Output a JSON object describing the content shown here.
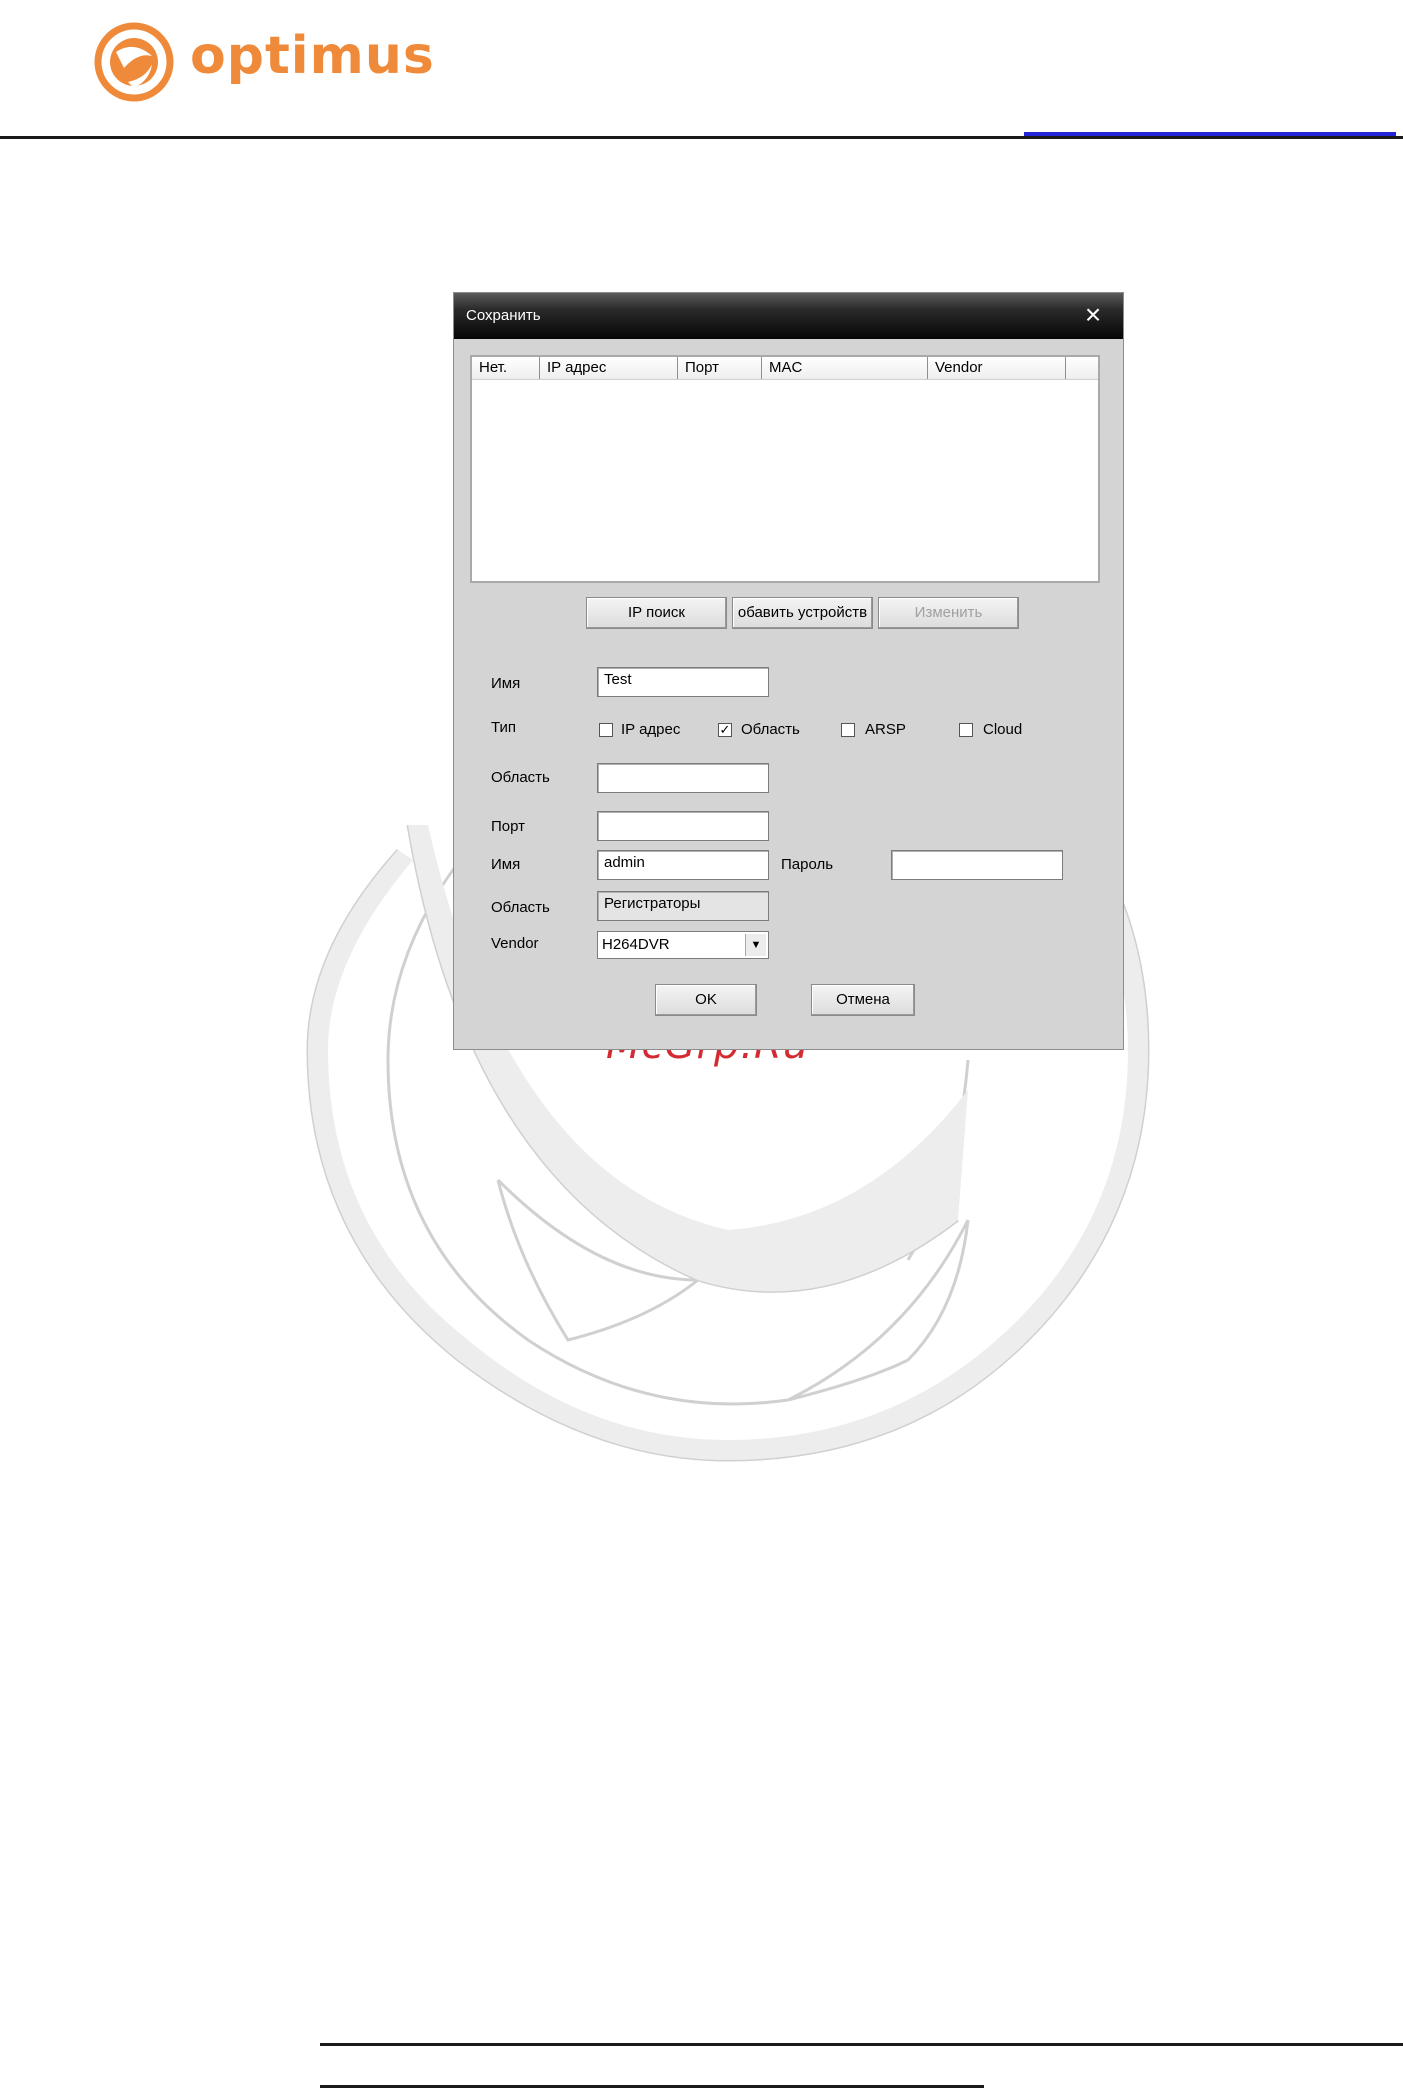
{
  "header": {
    "brand": "optimus",
    "brand_color": "#ef8a3a"
  },
  "watermark_text": "McGrp.Ru",
  "dialog": {
    "title": "Сохранить",
    "close_icon": "close-icon",
    "list": {
      "columns": [
        "Нет.",
        "IP адрес",
        "Порт",
        "MAC",
        "Vendor"
      ],
      "rows": []
    },
    "buttons": {
      "ip_search": "IP поиск",
      "add_device": "обавить устройств",
      "edit": "Изменить"
    },
    "form": {
      "name_label": "Имя",
      "name_value": "Test",
      "type_label": "Тип",
      "types": [
        {
          "label": "IP адрес",
          "checked": false
        },
        {
          "label": "Область",
          "checked": true
        },
        {
          "label": "ARSP",
          "checked": false
        },
        {
          "label": "Cloud",
          "checked": false
        }
      ],
      "area_label": "Область",
      "area_value": "",
      "port_label": "Порт",
      "port_value": "",
      "user_label": "Имя",
      "user_value": "admin",
      "password_label": "Пароль",
      "password_value": "",
      "group_label": "Область",
      "group_value": "Регистраторы",
      "vendor_label": "Vendor",
      "vendor_value": "H264DVR"
    },
    "ok": "OK",
    "cancel": "Отмена"
  }
}
